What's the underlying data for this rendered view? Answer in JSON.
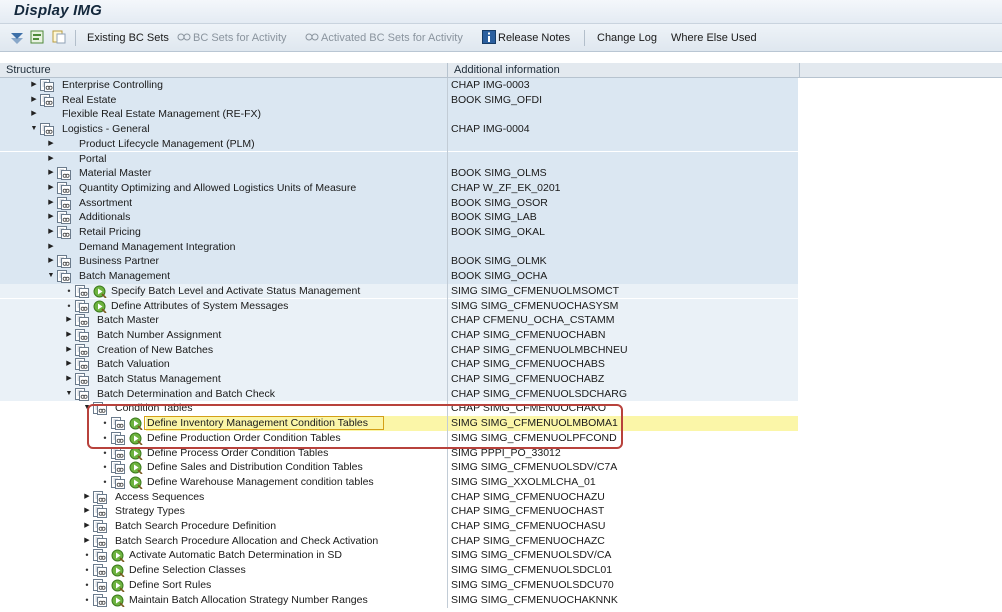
{
  "window": {
    "title": "Display IMG"
  },
  "toolbar": {
    "existing_bc_sets": "Existing BC Sets",
    "bc_sets_for_activity": "BC Sets for Activity",
    "activated_bc_sets_for_activity": "Activated BC Sets for Activity",
    "release_notes": "Release Notes",
    "change_log": "Change Log",
    "where_else_used": "Where Else Used"
  },
  "table": {
    "columns": [
      "Structure",
      "Additional information"
    ],
    "rows": [
      {
        "level": 1,
        "expander": "collapsed",
        "doc": true,
        "exec": false,
        "label": "Enterprise Controlling",
        "info": "CHAP IMG-0003",
        "band": "blue"
      },
      {
        "level": 1,
        "expander": "collapsed",
        "doc": true,
        "exec": false,
        "label": "Real Estate",
        "info": "BOOK SIMG_OFDI",
        "band": "blue"
      },
      {
        "level": 1,
        "expander": "collapsed",
        "doc": false,
        "exec": false,
        "label": "Flexible Real Estate Management (RE-FX)",
        "info": "",
        "band": "blue"
      },
      {
        "level": 1,
        "expander": "expanded",
        "doc": true,
        "exec": false,
        "label": "Logistics - General",
        "info": "CHAP IMG-0004",
        "band": "blue"
      },
      {
        "level": 2,
        "expander": "collapsed",
        "doc": false,
        "exec": false,
        "label": "Product Lifecycle Management (PLM)",
        "info": "",
        "band": "blue"
      },
      {
        "level": 2,
        "expander": "collapsed",
        "doc": false,
        "exec": false,
        "label": "Portal",
        "info": "",
        "band": "blue"
      },
      {
        "level": 2,
        "expander": "collapsed",
        "doc": true,
        "exec": false,
        "label": "Material Master",
        "info": "BOOK SIMG_OLMS",
        "band": "blue"
      },
      {
        "level": 2,
        "expander": "collapsed",
        "doc": true,
        "exec": false,
        "label": "Quantity Optimizing and Allowed Logistics Units of Measure",
        "info": "CHAP W_ZF_EK_0201",
        "band": "blue"
      },
      {
        "level": 2,
        "expander": "collapsed",
        "doc": true,
        "exec": false,
        "label": "Assortment",
        "info": "BOOK SIMG_OSOR",
        "band": "blue"
      },
      {
        "level": 2,
        "expander": "collapsed",
        "doc": true,
        "exec": false,
        "label": "Additionals",
        "info": "BOOK SIMG_LAB",
        "band": "blue"
      },
      {
        "level": 2,
        "expander": "collapsed",
        "doc": true,
        "exec": false,
        "label": "Retail Pricing",
        "info": "BOOK SIMG_OKAL",
        "band": "blue"
      },
      {
        "level": 2,
        "expander": "collapsed",
        "doc": false,
        "exec": false,
        "label": "Demand Management Integration",
        "info": "",
        "band": "blue"
      },
      {
        "level": 2,
        "expander": "collapsed",
        "doc": true,
        "exec": false,
        "label": "Business Partner",
        "info": "BOOK SIMG_OLMK",
        "band": "blue"
      },
      {
        "level": 2,
        "expander": "expanded",
        "doc": true,
        "exec": false,
        "label": "Batch Management",
        "info": "BOOK SIMG_OCHA",
        "band": "blue"
      },
      {
        "level": 3,
        "expander": "leaf",
        "doc": true,
        "exec": true,
        "label": "Specify Batch Level and Activate Status Management",
        "info": "SIMG SIMG_CFMENUOLMSOMCT",
        "band": "light"
      },
      {
        "level": 3,
        "expander": "leaf",
        "doc": true,
        "exec": true,
        "label": "Define Attributes of System Messages",
        "info": "SIMG SIMG_CFMENUOCHASYSM",
        "band": "light"
      },
      {
        "level": 3,
        "expander": "collapsed",
        "doc": true,
        "exec": false,
        "label": "Batch Master",
        "info": "CHAP CFMENU_OCHA_CSTAMM",
        "band": "light"
      },
      {
        "level": 3,
        "expander": "collapsed",
        "doc": true,
        "exec": false,
        "label": "Batch Number Assignment",
        "info": "CHAP SIMG_CFMENUOCHABN",
        "band": "light"
      },
      {
        "level": 3,
        "expander": "collapsed",
        "doc": true,
        "exec": false,
        "label": "Creation of New Batches",
        "info": "CHAP SIMG_CFMENUOLMBCHNEU",
        "band": "light"
      },
      {
        "level": 3,
        "expander": "collapsed",
        "doc": true,
        "exec": false,
        "label": "Batch Valuation",
        "info": "CHAP SIMG_CFMENUOCHABS",
        "band": "light"
      },
      {
        "level": 3,
        "expander": "collapsed",
        "doc": true,
        "exec": false,
        "label": "Batch Status Management",
        "info": "CHAP SIMG_CFMENUOCHABZ",
        "band": "light"
      },
      {
        "level": 3,
        "expander": "expanded",
        "doc": true,
        "exec": false,
        "label": "Batch Determination and Batch Check",
        "info": "CHAP SIMG_CFMENUOLSDCHARG",
        "band": "light"
      },
      {
        "level": 4,
        "expander": "expanded",
        "doc": true,
        "exec": false,
        "label": "Condition Tables",
        "info": "CHAP SIMG_CFMENUOCHAKO",
        "band": "white"
      },
      {
        "level": 5,
        "expander": "leaf",
        "doc": true,
        "exec": true,
        "label": "Define Inventory Management Condition Tables",
        "info": "SIMG SIMG_CFMENUOLMBOMA1",
        "band": "yellow"
      },
      {
        "level": 5,
        "expander": "leaf",
        "doc": true,
        "exec": true,
        "label": "Define Production Order Condition Tables",
        "info": "SIMG SIMG_CFMENUOLPFCOND",
        "band": "white"
      },
      {
        "level": 5,
        "expander": "leaf",
        "doc": true,
        "exec": true,
        "label": "Define Process Order Condition Tables",
        "info": "SIMG PPPI_PO_33012",
        "band": "white"
      },
      {
        "level": 5,
        "expander": "leaf",
        "doc": true,
        "exec": true,
        "label": "Define Sales and Distribution Condition Tables",
        "info": "SIMG SIMG_CFMENUOLSDV/C7A",
        "band": "white"
      },
      {
        "level": 5,
        "expander": "leaf",
        "doc": true,
        "exec": true,
        "label": "Define Warehouse Management condition tables",
        "info": "SIMG SIMG_XXOLMLCHA_01",
        "band": "white"
      },
      {
        "level": 4,
        "expander": "collapsed",
        "doc": true,
        "exec": false,
        "label": "Access Sequences",
        "info": "CHAP SIMG_CFMENUOCHAZU",
        "band": "white"
      },
      {
        "level": 4,
        "expander": "collapsed",
        "doc": true,
        "exec": false,
        "label": "Strategy Types",
        "info": "CHAP SIMG_CFMENUOCHAST",
        "band": "white"
      },
      {
        "level": 4,
        "expander": "collapsed",
        "doc": true,
        "exec": false,
        "label": "Batch Search Procedure Definition",
        "info": "CHAP SIMG_CFMENUOCHASU",
        "band": "white"
      },
      {
        "level": 4,
        "expander": "collapsed",
        "doc": true,
        "exec": false,
        "label": "Batch Search Procedure Allocation and Check Activation",
        "info": "CHAP SIMG_CFMENUOCHAZC",
        "band": "white"
      },
      {
        "level": 4,
        "expander": "leaf",
        "doc": true,
        "exec": true,
        "label": "Activate Automatic Batch Determination in SD",
        "info": "SIMG SIMG_CFMENUOLSDV/CA",
        "band": "white"
      },
      {
        "level": 4,
        "expander": "leaf",
        "doc": true,
        "exec": true,
        "label": "Define Selection Classes",
        "info": "SIMG SIMG_CFMENUOLSDCL01",
        "band": "white"
      },
      {
        "level": 4,
        "expander": "leaf",
        "doc": true,
        "exec": true,
        "label": "Define Sort Rules",
        "info": "SIMG SIMG_CFMENUOLSDCU70",
        "band": "white"
      },
      {
        "level": 4,
        "expander": "leaf",
        "doc": true,
        "exec": true,
        "label": "Maintain Batch Allocation Strategy Number Ranges",
        "info": "SIMG SIMG_CFMENUOCHAKNNK",
        "band": "white"
      }
    ]
  },
  "colors": {
    "band_blue": "#dbe7f2",
    "band_light": "#eaf1f7",
    "band_yellow": "#fbf6a8",
    "annotation_red": "#b8423c"
  }
}
